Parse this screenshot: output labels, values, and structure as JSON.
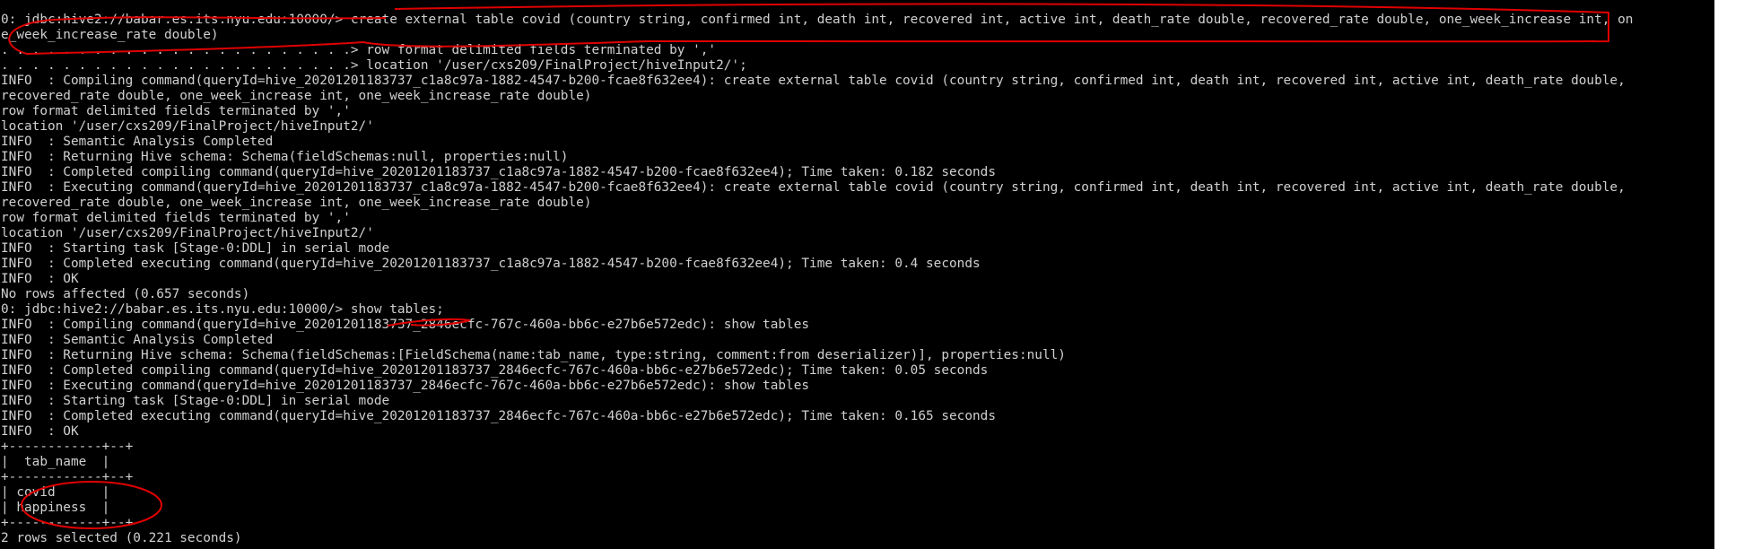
{
  "terminal": {
    "lines": [
      "0: jdbc:hive2://babar.es.its.nyu.edu:10000/> create external table covid (country string, confirmed int, death int, recovered int, active int, death_rate double, recovered_rate double, one_week_increase int, on",
      "e_week_increase_rate double)",
      ". . . . . . . . . . . . . . . . . . . . . . .> row format delimited fields terminated by ','",
      ". . . . . . . . . . . . . . . . . . . . . . .> location '/user/cxs209/FinalProject/hiveInput2/';",
      "INFO  : Compiling command(queryId=hive_20201201183737_c1a8c97a-1882-4547-b200-fcae8f632ee4): create external table covid (country string, confirmed int, death int, recovered int, active int, death_rate double,",
      "recovered_rate double, one_week_increase int, one_week_increase_rate double)",
      "row format delimited fields terminated by ','",
      "location '/user/cxs209/FinalProject/hiveInput2/'",
      "INFO  : Semantic Analysis Completed",
      "INFO  : Returning Hive schema: Schema(fieldSchemas:null, properties:null)",
      "INFO  : Completed compiling command(queryId=hive_20201201183737_c1a8c97a-1882-4547-b200-fcae8f632ee4); Time taken: 0.182 seconds",
      "INFO  : Executing command(queryId=hive_20201201183737_c1a8c97a-1882-4547-b200-fcae8f632ee4): create external table covid (country string, confirmed int, death int, recovered int, active int, death_rate double,",
      "recovered_rate double, one_week_increase int, one_week_increase_rate double)",
      "row format delimited fields terminated by ','",
      "location '/user/cxs209/FinalProject/hiveInput2/'",
      "INFO  : Starting task [Stage-0:DDL] in serial mode",
      "INFO  : Completed executing command(queryId=hive_20201201183737_c1a8c97a-1882-4547-b200-fcae8f632ee4); Time taken: 0.4 seconds",
      "INFO  : OK",
      "No rows affected (0.657 seconds)",
      "0: jdbc:hive2://babar.es.its.nyu.edu:10000/> show tables;",
      "INFO  : Compiling command(queryId=hive_20201201183737_2846ecfc-767c-460a-bb6c-e27b6e572edc): show tables",
      "INFO  : Semantic Analysis Completed",
      "INFO  : Returning Hive schema: Schema(fieldSchemas:[FieldSchema(name:tab_name, type:string, comment:from deserializer)], properties:null)",
      "INFO  : Completed compiling command(queryId=hive_20201201183737_2846ecfc-767c-460a-bb6c-e27b6e572edc); Time taken: 0.05 seconds",
      "INFO  : Executing command(queryId=hive_20201201183737_2846ecfc-767c-460a-bb6c-e27b6e572edc): show tables",
      "INFO  : Starting task [Stage-0:DDL] in serial mode",
      "INFO  : Completed executing command(queryId=hive_20201201183737_2846ecfc-767c-460a-bb6c-e27b6e572edc); Time taken: 0.165 seconds",
      "INFO  : OK",
      "+------------+--+",
      "|  tab_name  |",
      "+------------+--+",
      "| covid      |",
      "| happiness  |",
      "+------------+--+",
      "2 rows selected (0.221 seconds)"
    ]
  },
  "colors": {
    "terminal_bg": "#000000",
    "terminal_text": "#d0d0d0",
    "annotation": "#e00000"
  }
}
